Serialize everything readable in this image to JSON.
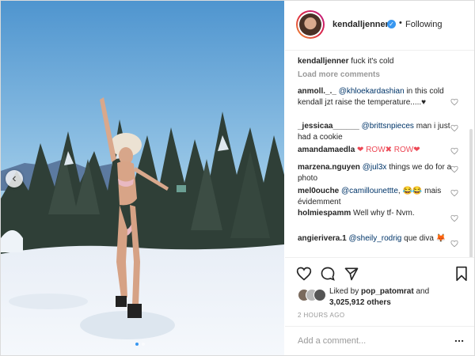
{
  "post": {
    "author": "kendalljenner",
    "follow_status": "Following",
    "separator": "•",
    "verified_glyph": "✓",
    "caption": "fuck it's cold",
    "load_more": "Load more comments"
  },
  "comments": [
    {
      "user": "anmoll._._",
      "mention": "@khloekardashian",
      "text": " in this cold kendall jzt raise the temperature.....♥"
    },
    {
      "user": "_jessicaa______",
      "mention": "@brittsnpieces",
      "text": " man i just had a cookie"
    },
    {
      "user": "amandamaedla",
      "mention": "",
      "text": "❤ ROW✖ ROW❤"
    },
    {
      "user": "marzena.nguyen",
      "mention": "@jul3x",
      "text": " things we do for a photo"
    },
    {
      "user": "mel0ouche",
      "mention": "@camillounettte",
      "text": ", 😂😂 mais évidemment"
    },
    {
      "user": "holmiespamm",
      "mention": "",
      "text": "Well why tf- Nvm."
    },
    {
      "user": "angierivera.1",
      "mention": "@sheily_rodrig",
      "text": " que diva 🦊"
    }
  ],
  "likes": {
    "liked_by_prefix": "Liked by",
    "liked_by_user": "pop_patomrat",
    "joiner": "and",
    "others": "3,025,912 others"
  },
  "timestamp": "2 HOURS AGO",
  "add_comment_placeholder": "Add a comment...",
  "icons": [
    "heart-icon",
    "comment-icon",
    "share-icon",
    "bookmark-icon",
    "more-icon",
    "chevron-left-icon",
    "verified-icon"
  ],
  "colors": {
    "accent": "#3897f0",
    "like_red": "#ed4956",
    "mention": "#003569",
    "muted": "#999999"
  }
}
